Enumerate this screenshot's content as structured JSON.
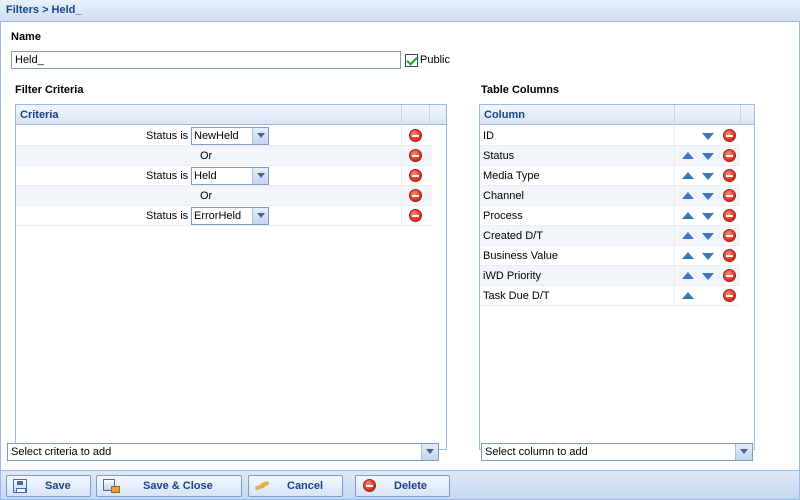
{
  "window": {
    "breadcrumb": "Filters > Held_"
  },
  "name_section": {
    "label": "Name",
    "value": "Held_",
    "public_label": "Public",
    "public_checked": true
  },
  "filter_criteria": {
    "section_label": "Filter Criteria",
    "header": "Criteria",
    "rows": [
      {
        "type": "condition",
        "label": "Status is",
        "value": "NewHeld"
      },
      {
        "type": "operator",
        "label": "Or"
      },
      {
        "type": "condition",
        "label": "Status is",
        "value": "Held"
      },
      {
        "type": "operator",
        "label": "Or"
      },
      {
        "type": "condition",
        "label": "Status is",
        "value": "ErrorHeld"
      }
    ],
    "add_placeholder": "Select criteria to add"
  },
  "table_columns": {
    "section_label": "Table Columns",
    "header": "Column",
    "rows": [
      {
        "label": "ID",
        "up": false,
        "down": true
      },
      {
        "label": "Status",
        "up": true,
        "down": true
      },
      {
        "label": "Media Type",
        "up": true,
        "down": true
      },
      {
        "label": "Channel",
        "up": true,
        "down": true
      },
      {
        "label": "Process",
        "up": true,
        "down": true
      },
      {
        "label": "Created D/T",
        "up": true,
        "down": true
      },
      {
        "label": "Business Value",
        "up": true,
        "down": true
      },
      {
        "label": "iWD Priority",
        "up": true,
        "down": true
      },
      {
        "label": "Task Due D/T",
        "up": true,
        "down": false
      }
    ],
    "add_placeholder": "Select column to add"
  },
  "toolbar": {
    "save": "Save",
    "save_close": "Save & Close",
    "cancel": "Cancel",
    "delete": "Delete"
  },
  "icons": {
    "remove": "minus-circle-icon",
    "move_up": "arrow-up-icon",
    "move_down": "arrow-down-icon",
    "save": "disk-icon",
    "save_close": "disk-close-icon",
    "cancel": "cancel-arrow-icon",
    "delete": "minus-circle-icon"
  },
  "colors": {
    "accent": "#15428b",
    "border": "#99bbe8",
    "remove": "#d62b1a",
    "arrow": "#3a76c4"
  }
}
